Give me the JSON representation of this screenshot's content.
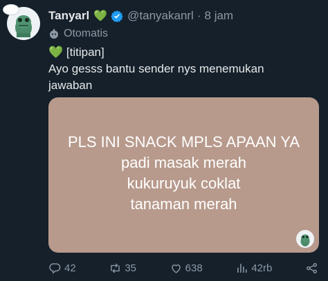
{
  "user": {
    "name": "Tanyarl",
    "handle": "@tanyakanrl",
    "separator": "·",
    "time": "8 jam",
    "automated_label": "Otomatis"
  },
  "tweet": {
    "line1": "💚 [titipan]",
    "line2": "Ayo gesss bantu sender nys menemukan",
    "line3": "jawaban"
  },
  "media": {
    "line1": "PLS INI SNACK MPLS APAAN YA",
    "line2": "padi masak merah",
    "line3": "kukuruyuk coklat",
    "line4": "tanaman merah"
  },
  "actions": {
    "replies": "42",
    "retweets": "35",
    "likes": "638",
    "views": "42rb"
  },
  "colors": {
    "background": "#15202b",
    "media_background": "#b79a8c",
    "verified_blue": "#1d9bf0",
    "heart_green": "#3bb54a",
    "muted_text": "#8b98a5"
  }
}
